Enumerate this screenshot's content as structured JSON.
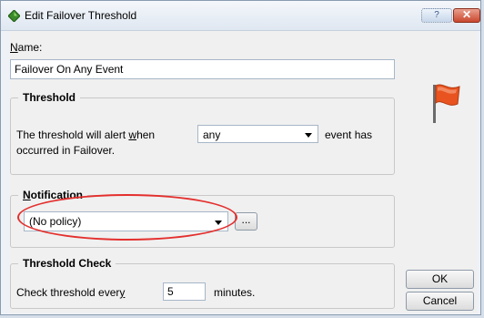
{
  "window": {
    "title": "Edit Failover Threshold",
    "help_glyph": "?",
    "close_glyph": "✕"
  },
  "name": {
    "label_mnemonic": "N",
    "label_rest": "ame:",
    "value": "Failover On Any Event"
  },
  "threshold": {
    "group_title": "Threshold",
    "text_before": "The threshold will alert ",
    "text_mnemonic": "w",
    "text_after_mnemonic": "hen",
    "select_value": "any",
    "text_after": "event has",
    "text_line2": "occurred in Failover."
  },
  "notification": {
    "group_title_mnemonic": "N",
    "group_title_rest": "otification",
    "select_value": "(No policy)",
    "browse_label": "..."
  },
  "threshold_check": {
    "group_title": "Threshold Check",
    "text_before": "Check threshold ever",
    "text_mnemonic": "y",
    "value": "5",
    "text_after": "minutes."
  },
  "buttons": {
    "ok": "OK",
    "cancel": "Cancel"
  },
  "colors": {
    "flag": "#e8531f",
    "annotation": "#e3302e"
  },
  "icons": {
    "title": "green-gem-icon",
    "flag": "flag-icon"
  }
}
